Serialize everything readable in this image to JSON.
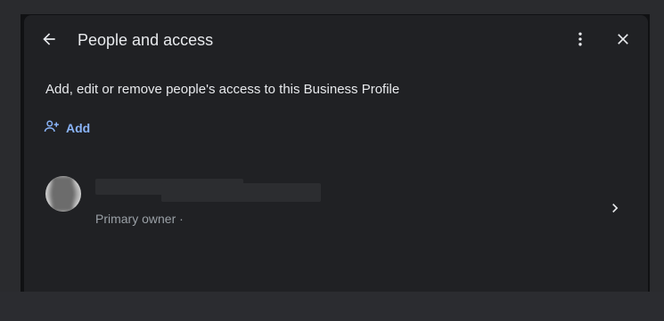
{
  "dialog": {
    "title": "People and access",
    "description": "Add, edit or remove people's access to this Business Profile",
    "add_label": "Add",
    "icons": {
      "back": "arrow-back-icon",
      "more": "more-vert-icon",
      "close": "close-icon",
      "add": "person-add-icon",
      "chevron": "chevron-right-icon"
    }
  },
  "people": [
    {
      "name": "",
      "role": "Primary owner ·",
      "email": ""
    }
  ],
  "colors": {
    "dialog_bg": "#202124",
    "text_primary": "#e8eaed",
    "text_secondary": "#9aa0a6",
    "accent": "#8ab4f8"
  }
}
